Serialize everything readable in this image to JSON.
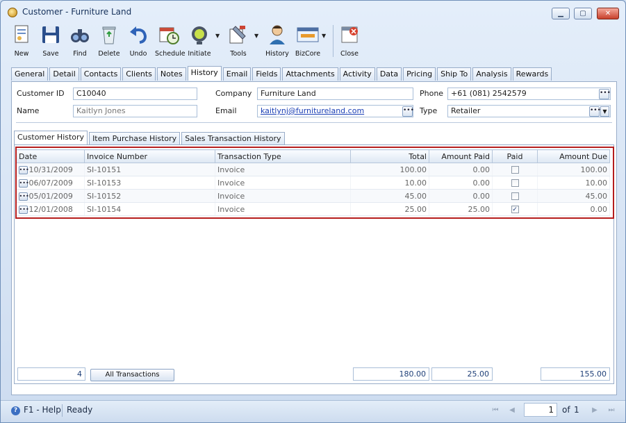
{
  "window": {
    "title": "Customer - Furniture Land",
    "minimize": "▁",
    "maximize": "▢",
    "close": "✕"
  },
  "toolbar": [
    {
      "label": "New",
      "icon": "new-document-icon"
    },
    {
      "label": "Save",
      "icon": "floppy-disk-icon"
    },
    {
      "label": "Find",
      "icon": "binoculars-icon"
    },
    {
      "label": "Delete",
      "icon": "recycle-bin-icon"
    },
    {
      "label": "Undo",
      "icon": "undo-arrow-icon"
    },
    {
      "label": "Schedule",
      "icon": "calendar-clock-icon"
    },
    {
      "label": "Initiate",
      "icon": "traffic-light-icon"
    },
    {
      "label": "Tools",
      "icon": "tools-icon"
    },
    {
      "label": "History",
      "icon": "person-history-icon"
    },
    {
      "label": "BizCore",
      "icon": "bizcore-icon"
    },
    {
      "label": "Close",
      "icon": "close-window-icon"
    }
  ],
  "tabs": [
    "General",
    "Detail",
    "Contacts",
    "Clients",
    "Notes",
    "History",
    "Email",
    "Fields",
    "Attachments",
    "Activity",
    "Data",
    "Pricing",
    "Ship To",
    "Analysis",
    "Rewards"
  ],
  "active_tab": "History",
  "form": {
    "customer_id_label": "Customer ID",
    "customer_id": "C10040",
    "name_label": "Name",
    "name": "Kaitlyn Jones",
    "company_label": "Company",
    "company": "Furniture Land",
    "email_label": "Email",
    "email": "kaitlynj@furnitureland.com",
    "phone_label": "Phone",
    "phone": "+61 (081) 2542579",
    "type_label": "Type",
    "type": "Retailer"
  },
  "subtabs": [
    "Customer History",
    "Item Purchase History",
    "Sales Transaction History"
  ],
  "grid": {
    "columns": [
      "Date",
      "Invoice Number",
      "Transaction Type",
      "Total",
      "Amount Paid",
      "Paid",
      "Amount Due"
    ],
    "rows": [
      {
        "date": "10/31/2009",
        "invoice": "SI-10151",
        "type": "Invoice",
        "total": "100.00",
        "paid_amount": "0.00",
        "paid": false,
        "due": "100.00"
      },
      {
        "date": "06/07/2009",
        "invoice": "SI-10153",
        "type": "Invoice",
        "total": "10.00",
        "paid_amount": "0.00",
        "paid": false,
        "due": "10.00"
      },
      {
        "date": "05/01/2009",
        "invoice": "SI-10152",
        "type": "Invoice",
        "total": "45.00",
        "paid_amount": "0.00",
        "paid": false,
        "due": "45.00"
      },
      {
        "date": "12/01/2008",
        "invoice": "SI-10154",
        "type": "Invoice",
        "total": "25.00",
        "paid_amount": "25.00",
        "paid": true,
        "due": "0.00"
      }
    ],
    "footer": {
      "count": "4",
      "all_button": "All Transactions",
      "total": "180.00",
      "paid": "25.00",
      "due": "155.00"
    }
  },
  "status": {
    "help": "F1 - Help",
    "state": "Ready",
    "page": "1",
    "of": "of",
    "pages": "1"
  },
  "colors": {
    "highlight": "#b51d1d",
    "link": "#1a3fb5",
    "accent": "#3b6fc2"
  }
}
